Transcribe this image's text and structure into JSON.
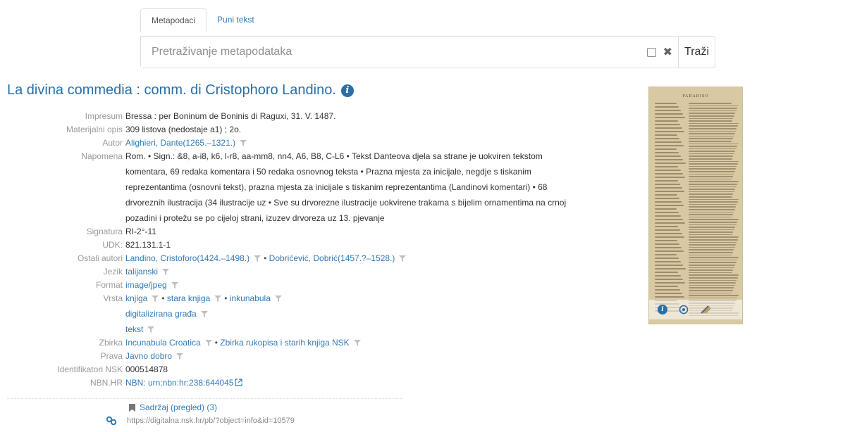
{
  "tabs": [
    {
      "label": "Metapodaci",
      "active": true
    },
    {
      "label": "Puni tekst",
      "active": false
    }
  ],
  "search": {
    "placeholder": "Pretraživanje metapodataka",
    "value": "",
    "button_label": "Traži",
    "clear_icon": "close-icon"
  },
  "record": {
    "title": "La divina commedia : comm. di Cristophoro Landino.",
    "impresum": {
      "label": "Impresum",
      "value": "Bressa : per Boninum de Boninis di Raguxi, 31. V. 1487."
    },
    "materijalni_opis": {
      "label": "Materijalni opis",
      "value": "309 listova (nedostaje a1) ; 2o."
    },
    "autor": {
      "label": "Autor",
      "value": "Alighieri, Dante(1265.–1321.)"
    },
    "napomena": {
      "label": "Napomena",
      "lines": [
        "Rom.   • Sign.: &8, a-i8, k6, l-r8, aa-mm8, nn4, A6, B8, C-L6   • Tekst Danteova djela sa strane je uokviren tekstom",
        "komentara, 69 redaka komentara i 50 redaka osnovnog teksta   • Prazna mjesta za inicijale, negdje s tiskanim",
        "reprezentantima (osnovni tekst), prazna mjesta za inicijale s tiskanim reprezentantima (Landinovi komentari)   • 68",
        "drvoreznih ilustracija (34 ilustracije uz   • Sve su drvorezne ilustracije uokvirene trakama s bijelim ornamentima na crnoj",
        "pozadini i protežu se po cijeloj strani, izuzev drvoreza uz 13. pjevanje"
      ]
    },
    "signatura": {
      "label": "Signatura",
      "value": "RI-2°-11"
    },
    "udk": {
      "label": "UDK:",
      "value": "821.131.1-1"
    },
    "ostali_autori": {
      "label": "Ostali autori",
      "values": [
        "Landino, Cristoforo(1424.–1498.)",
        "Dobrićević, Dobrić(1457.?–1528.)"
      ]
    },
    "jezik": {
      "label": "Jezik",
      "value": "talijanski"
    },
    "format": {
      "label": "Format",
      "value": "image/jpeg"
    },
    "vrsta": {
      "label": "Vrsta",
      "values": [
        "knjiga",
        "stara knjiga",
        "inkunabula",
        "digitalizirana građa",
        "tekst"
      ]
    },
    "zbirka": {
      "label": "Zbirka",
      "values": [
        "Incunabula Croatica",
        "Zbirka rukopisa i starih knjiga NSK"
      ]
    },
    "prava": {
      "label": "Prava",
      "value": "Javno dobro"
    },
    "identifikatori": {
      "label": "Identifikatori NSK",
      "value": "000514878"
    },
    "nbn": {
      "label": "NBN.HR",
      "value": "NBN: urn:nbn:hr:238:644045"
    }
  },
  "contents_link": "Sadržaj (pregled) (3)",
  "permalink": "https://digitalna.nsk.hr/pb/?object=info&id=10579",
  "thumbnail": {
    "heading": "PARADISO"
  },
  "colors": {
    "link": "#337ab7",
    "title": "#2a6fa8",
    "label": "#999999"
  }
}
